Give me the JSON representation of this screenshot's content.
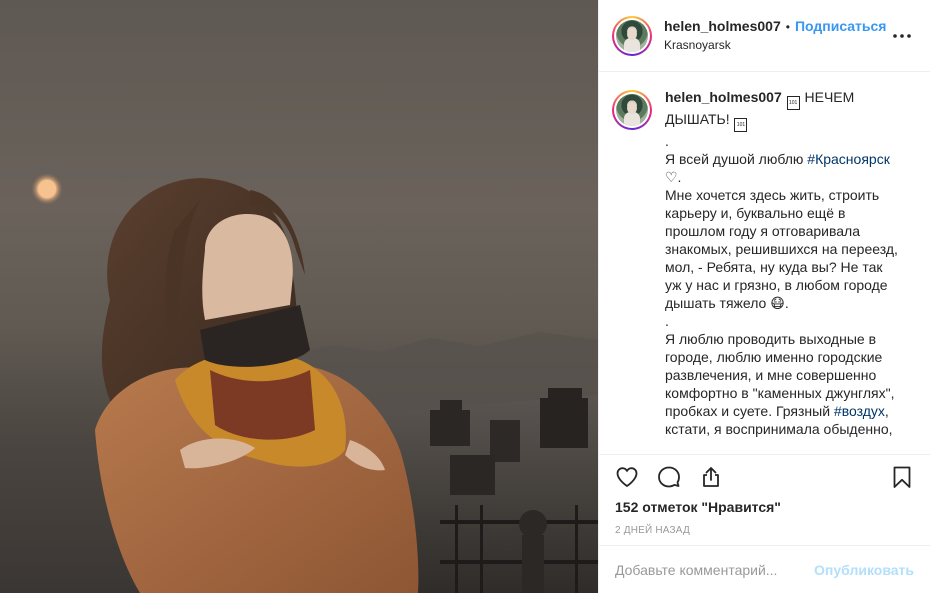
{
  "post": {
    "username": "helen_holmes007",
    "separator": "•",
    "follow_label": "Подписаться",
    "location": "Krasnoyarsk",
    "more_label": "•••"
  },
  "caption": {
    "username": "helen_holmes007",
    "box_glyph": "⬚",
    "title_part1": " НЕЧЕМ ДЫШАТЬ! ",
    "line_dot1": ".",
    "line_love_prefix": "Я всей душой люблю ",
    "hashtag1": "#Красноярск",
    "line_heart": "♡.",
    "para1": "Мне хочется здесь жить, строить карьеру и, буквально ещё в прошлом году я отговаривала знакомых, решившихся на переезд, мол, - Ребята, ну куда вы? Не так уж у нас и грязно, в любом городе дышать тяжело 😷.",
    "line_dot2": ".",
    "para2_prefix": "Я люблю проводить выходные в городе, люблю именно городские развлечения, и мне совершенно комфортно в \"каменных джунглях\", пробках и суете. Грязный ",
    "hashtag2": "#воздух",
    "para2_suffix": ", кстати, я воспринимала обыденно,"
  },
  "actions": {
    "like_icon": "heart-icon",
    "comment_icon": "comment-icon",
    "share_icon": "share-icon",
    "save_icon": "bookmark-icon",
    "likes_text": "152 отметок \"Нравится\"",
    "time_text": "2 дней назад"
  },
  "comment_box": {
    "placeholder": "Добавьте комментарий...",
    "publish_label": "Опубликовать"
  },
  "colors": {
    "link": "#3897f0",
    "hashtag": "#003569",
    "publish_disabled": "#b2dffc",
    "border": "#efefef"
  }
}
